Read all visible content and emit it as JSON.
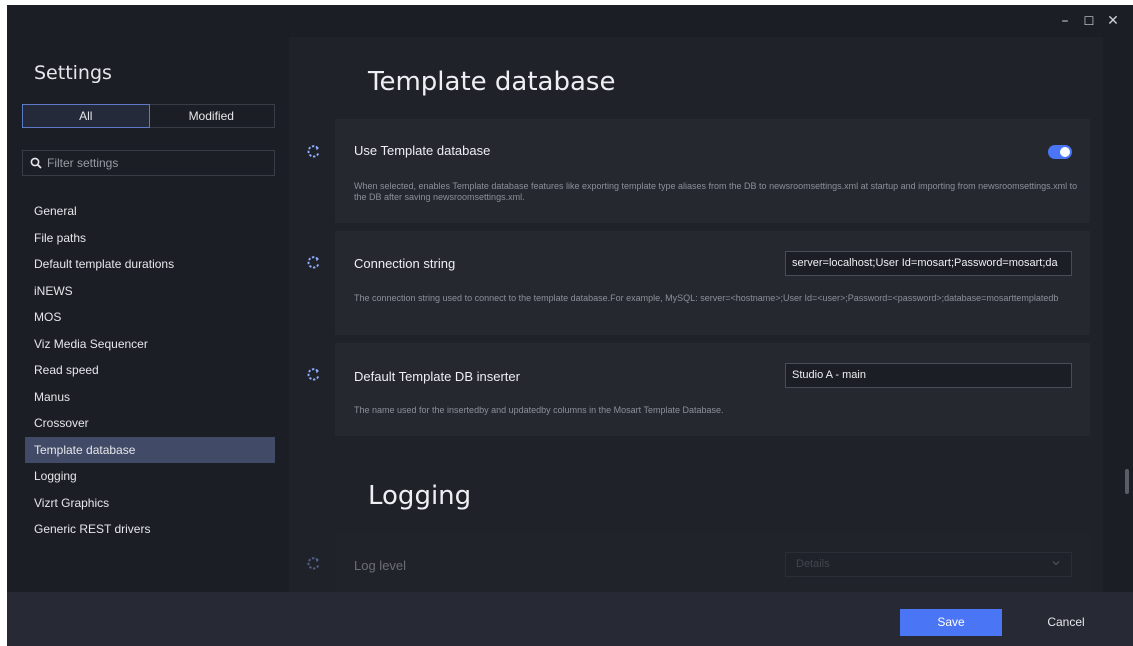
{
  "window": {
    "minimize_glyph": "–",
    "maximize_glyph": "☐",
    "close_glyph": "✕"
  },
  "sidebar": {
    "title": "Settings",
    "toggle": {
      "all_label": "All",
      "modified_label": "Modified",
      "selected": "All"
    },
    "filter": {
      "placeholder": "Filter settings",
      "value": "",
      "icon": "search-icon"
    },
    "items": [
      {
        "label": "General"
      },
      {
        "label": "File paths"
      },
      {
        "label": "Default template durations"
      },
      {
        "label": "iNEWS"
      },
      {
        "label": "MOS"
      },
      {
        "label": "Viz Media Sequencer"
      },
      {
        "label": "Read speed"
      },
      {
        "label": "Manus"
      },
      {
        "label": "Crossover"
      },
      {
        "label": "Template database"
      },
      {
        "label": "Logging"
      },
      {
        "label": "Vizrt Graphics"
      },
      {
        "label": "Generic REST drivers"
      }
    ],
    "selected_item": "Template database"
  },
  "main": {
    "sections": [
      {
        "heading": "Template database",
        "settings": [
          {
            "title": "Use Template database",
            "description": "When selected, enables Template database features like exporting template type aliases from the DB to newsroomsettings.xml at startup and importing from newsroomsettings.xml to the DB after saving newsroomsettings.xml.",
            "control": "toggle",
            "enabled": true
          },
          {
            "title": "Connection string",
            "description": "The connection string used to connect to the template database.For example, MySQL: server=<hostname>;User Id=<user>;Password=<password>;database=mosarttemplatedb",
            "control": "text",
            "value": "server=localhost;User Id=mosart;Password=mosart;da"
          },
          {
            "title": "Default Template DB inserter",
            "description": "The name used for the insertedby and updatedby columns in the Mosart Template Database.",
            "control": "text",
            "value": "Studio A - main"
          }
        ]
      },
      {
        "heading": "Logging",
        "settings": [
          {
            "title": "Log level",
            "control": "select",
            "value": "Details"
          }
        ]
      }
    ]
  },
  "footer": {
    "save_label": "Save",
    "cancel_label": "Cancel"
  },
  "colors": {
    "accent": "#4a75f5",
    "window_bg": "#1c1e25",
    "selected_nav": "#414a66",
    "card_bg": "#262830"
  }
}
